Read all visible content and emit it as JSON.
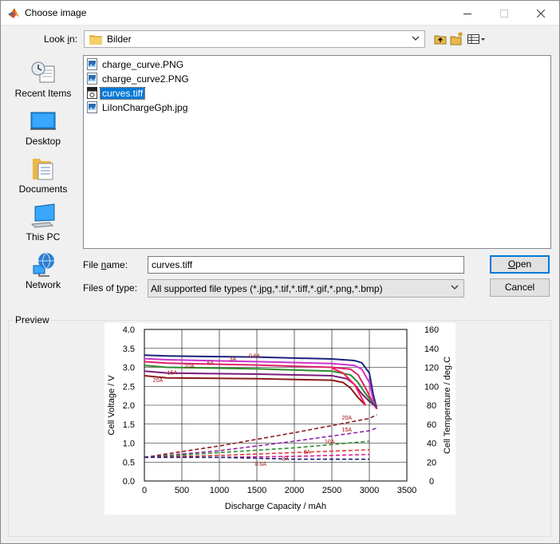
{
  "window": {
    "title": "Choose image"
  },
  "look_in": {
    "label_prefix": "Look ",
    "label_access": "i",
    "label_suffix": "n:",
    "value": "Bilder"
  },
  "toolbar": {
    "icons": [
      "up-folder-icon",
      "new-folder-icon",
      "view-menu-icon"
    ]
  },
  "sidebar": {
    "items": [
      {
        "label": "Recent Items",
        "icon": "recent-items-icon"
      },
      {
        "label": "Desktop",
        "icon": "desktop-icon"
      },
      {
        "label": "Documents",
        "icon": "documents-icon"
      },
      {
        "label": "This PC",
        "icon": "computer-icon"
      },
      {
        "label": "Network",
        "icon": "network-icon"
      }
    ]
  },
  "files": [
    {
      "name": "charge_curve.PNG",
      "selected": false
    },
    {
      "name": "charge_curve2.PNG",
      "selected": false
    },
    {
      "name": "curves.tiff",
      "selected": true
    },
    {
      "name": "LiIonChargeGph.jpg",
      "selected": false
    }
  ],
  "file_name": {
    "label_prefix": "File ",
    "label_access": "n",
    "label_suffix": "ame:",
    "value": "curves.tiff"
  },
  "file_type": {
    "label_prefix": "Files of ",
    "label_access": "t",
    "label_suffix": "ype:",
    "value": "All supported file types (*.jpg,*.tif,*.tiff,*.gif,*.png,*.bmp)"
  },
  "buttons": {
    "open_access": "O",
    "open_rest": "pen",
    "cancel": "Cancel"
  },
  "preview": {
    "label": "Preview"
  },
  "chart_data": {
    "type": "line",
    "xlabel": "Discharge Capacity / mAh",
    "ylabel": "Cell  Voltage / V",
    "y2label": "Cell Temperature / deg.C",
    "xlim": [
      0,
      3500
    ],
    "ylim": [
      0,
      4.0
    ],
    "y2lim": [
      0,
      160
    ],
    "xticks": [
      "0",
      "500",
      "1000",
      "1500",
      "2000",
      "2500",
      "3000",
      "3500"
    ],
    "yticks": [
      "0.0",
      "0.5",
      "1.0",
      "1.5",
      "2.0",
      "2.5",
      "3.0",
      "3.5",
      "4.0"
    ],
    "y2ticks": [
      "0",
      "20",
      "40",
      "60",
      "80",
      "100",
      "120",
      "140",
      "160"
    ],
    "grid": true,
    "voltage_series": [
      {
        "name": "0.6A",
        "color": "#1a237e",
        "x": [
          0,
          300,
          1500,
          2500,
          2800,
          2900,
          3000,
          3050,
          3100
        ],
        "values": [
          3.32,
          3.3,
          3.27,
          3.22,
          3.18,
          3.12,
          2.85,
          2.3,
          1.9
        ]
      },
      {
        "name": "3A",
        "color": "#cc33cc",
        "x": [
          0,
          300,
          1500,
          2500,
          2800,
          2900,
          3000,
          3050,
          3100
        ],
        "values": [
          3.23,
          3.2,
          3.15,
          3.1,
          3.05,
          2.95,
          2.6,
          2.15,
          1.9
        ]
      },
      {
        "name": "6A",
        "color": "#e0206e",
        "x": [
          0,
          300,
          1500,
          2500,
          2750,
          2850,
          2950,
          3050,
          3100
        ],
        "values": [
          3.15,
          3.11,
          3.06,
          3.0,
          2.95,
          2.8,
          2.45,
          2.05,
          1.9
        ]
      },
      {
        "name": "10A",
        "color": "#2e8b2e",
        "x": [
          0,
          300,
          1500,
          2500,
          2750,
          2850,
          2950,
          3050,
          3100
        ],
        "values": [
          3.05,
          3.0,
          2.96,
          2.9,
          2.8,
          2.6,
          2.3,
          2.05,
          1.95
        ]
      },
      {
        "name": "15A",
        "color": "#7a1a7a",
        "x": [
          0,
          300,
          1500,
          2500,
          2700,
          2800,
          2900,
          3000,
          3100
        ],
        "values": [
          2.9,
          2.85,
          2.82,
          2.78,
          2.7,
          2.55,
          2.3,
          2.1,
          1.95
        ]
      },
      {
        "name": "20A",
        "color": "#8b1a1a",
        "x": [
          0,
          300,
          1500,
          2500,
          2650,
          2750,
          2850,
          2950
        ],
        "values": [
          2.78,
          2.72,
          2.7,
          2.66,
          2.6,
          2.45,
          2.2,
          2.0
        ]
      },
      {
        "name": "",
        "color": "#ff2060",
        "x": [
          2500,
          2650,
          2800,
          2950
        ],
        "values": [
          2.98,
          2.85,
          2.55,
          2.0
        ]
      }
    ],
    "temperature_series": [
      {
        "name": "20A",
        "color": "#8b1a1a",
        "x": [
          0,
          1000,
          2000,
          3000,
          3100
        ],
        "values": [
          25,
          37,
          51,
          66,
          70
        ]
      },
      {
        "name": "15A",
        "color": "#8e24aa",
        "x": [
          0,
          1000,
          2000,
          3000,
          3100
        ],
        "values": [
          25,
          32,
          42,
          53,
          56
        ]
      },
      {
        "name": "10A",
        "color": "#2e8b2e",
        "x": [
          0,
          1000,
          2000,
          3000
        ],
        "values": [
          25,
          30,
          35,
          42
        ]
      },
      {
        "name": "6A",
        "color": "#e53935",
        "x": [
          0,
          1000,
          2000,
          3000
        ],
        "values": [
          25,
          27,
          30,
          33
        ]
      },
      {
        "name": "3A",
        "color": "#d81b9a",
        "x": [
          0,
          1000,
          2000,
          3000
        ],
        "values": [
          25,
          25,
          26,
          28
        ]
      },
      {
        "name": "0.6A",
        "color": "#1a237e",
        "x": [
          0,
          1000,
          2000,
          3000
        ],
        "values": [
          25,
          25,
          23,
          23
        ]
      }
    ],
    "labels": [
      {
        "text": "0.6A",
        "x": 1470,
        "y": 3.32
      },
      {
        "text": "3A",
        "x": 1180,
        "y": 3.23
      },
      {
        "text": "6A",
        "x": 880,
        "y": 3.13
      },
      {
        "text": "10A",
        "x": 600,
        "y": 3.04
      },
      {
        "text": "15A",
        "x": 370,
        "y": 2.87
      },
      {
        "text": "20A",
        "x": 180,
        "y": 2.67
      },
      {
        "text": "20A",
        "x": 2700,
        "y": 1.68
      },
      {
        "text": "15A",
        "x": 2700,
        "y": 1.37
      },
      {
        "text": "10A",
        "x": 2470,
        "y": 1.05
      },
      {
        "text": "6A",
        "x": 2170,
        "y": 0.78
      },
      {
        "text": "3A",
        "x": 1880,
        "y": 0.6
      },
      {
        "text": "0.6A",
        "x": 1550,
        "y": 0.46
      }
    ]
  }
}
